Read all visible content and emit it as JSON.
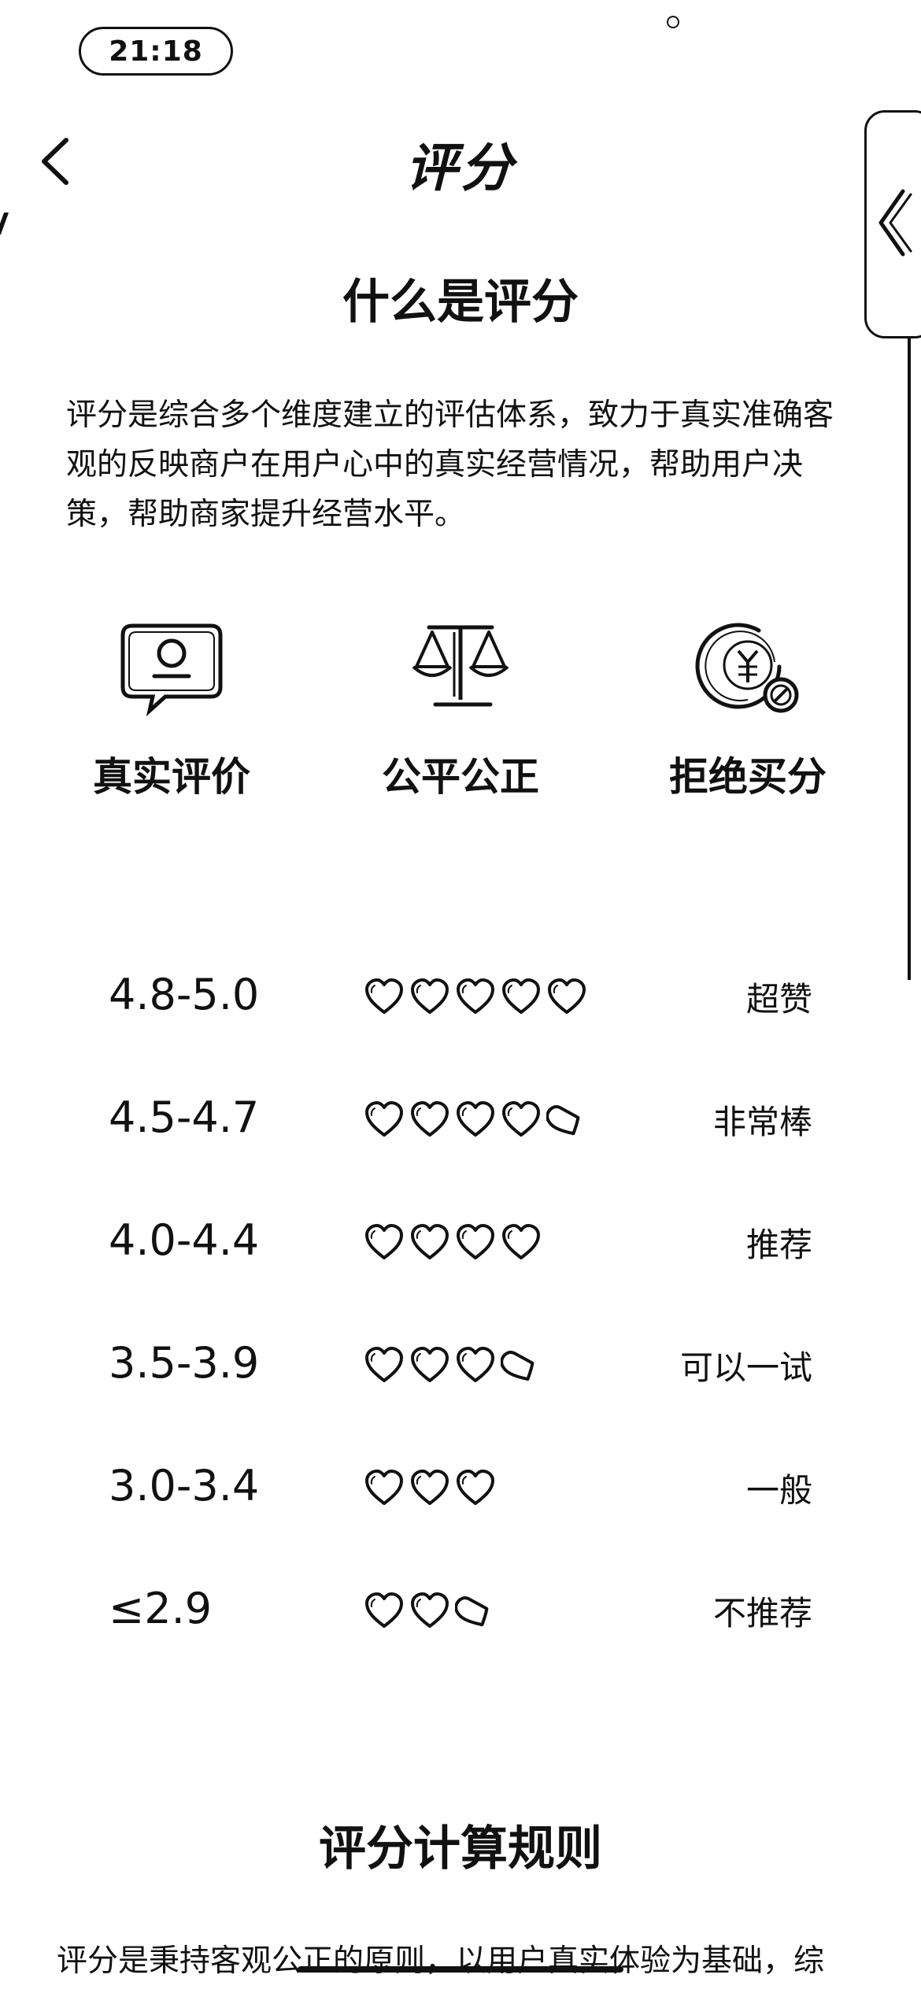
{
  "status_bar": {
    "time": "21:18"
  },
  "nav": {
    "title": "评分"
  },
  "intro": {
    "heading": "什么是评分",
    "paragraph": "评分是综合多个维度建立的评估体系，致力于真实准确客观的反映商户在用户心中的真实经营情况，帮助用户决策，帮助商家提升经营水平。"
  },
  "features": [
    {
      "label": "真实评价",
      "icon": "review-icon"
    },
    {
      "label": "公平公正",
      "icon": "scale-icon"
    },
    {
      "label": "拒绝买分",
      "icon": "no-money-icon"
    }
  ],
  "ratings": [
    {
      "range": "4.8-5.0",
      "hearts": 5,
      "desc": "超赞"
    },
    {
      "range": "4.5-4.7",
      "hearts": 4.5,
      "desc": "非常棒"
    },
    {
      "range": "4.0-4.4",
      "hearts": 4,
      "desc": "推荐"
    },
    {
      "range": "3.5-3.9",
      "hearts": 3.5,
      "desc": "可以一试"
    },
    {
      "range": "3.0-3.4",
      "hearts": 3,
      "desc": "一般"
    },
    {
      "range": "≤2.9",
      "hearts": 2.5,
      "desc": "不推荐"
    }
  ],
  "rules": {
    "heading": "评分计算规则",
    "paragraph": "评分是秉持客观公正的原则，以用户真实体验为基础，综"
  }
}
